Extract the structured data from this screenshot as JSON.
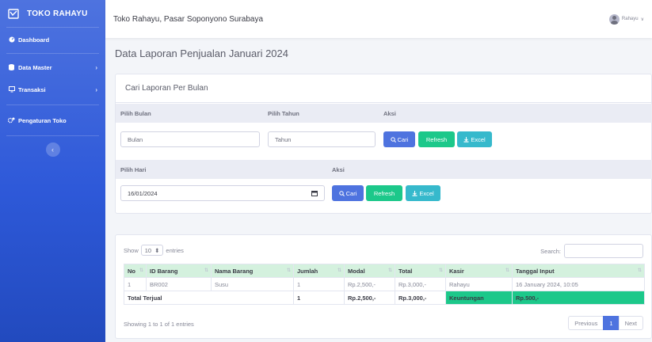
{
  "app": {
    "brand": "TOKO RAHAYU"
  },
  "sidebar": {
    "items": [
      {
        "label": "Dashboard",
        "icon": "tachometer-icon"
      },
      {
        "label": "Data Master",
        "icon": "database-icon"
      },
      {
        "label": "Transaksi",
        "icon": "desktop-icon"
      },
      {
        "label": "Pengaturan Toko",
        "icon": "cogs-icon"
      }
    ]
  },
  "topbar": {
    "title": "Toko Rahayu, Pasar Soponyono Surabaya",
    "user": "Rahayu"
  },
  "page": {
    "title": "Data Laporan Penjualan Januari 2024"
  },
  "filter": {
    "header": "Cari Laporan Per Bulan",
    "month_label": "Pilih Bulan",
    "year_label": "Pilih Tahun",
    "action_label": "Aksi",
    "month_placeholder": "Bulan",
    "year_placeholder": "Tahun",
    "day_label": "Pilih Hari",
    "day_action_label": "Aksi",
    "day_value": "16/01/2024",
    "btn_search": "Cari",
    "btn_refresh": "Refresh",
    "btn_excel": "Excel"
  },
  "table": {
    "show": "Show",
    "entries_value": "10",
    "entries": "entries",
    "search_label": "Search:",
    "columns": [
      "No",
      "ID Barang",
      "Nama Barang",
      "Jumlah",
      "Modal",
      "Total",
      "Kasir",
      "Tanggal Input"
    ],
    "rows": [
      [
        "1",
        "BR002",
        "Susu",
        "1",
        "Rp.2,500,-",
        "Rp.3,000,-",
        "Rahayu",
        "16 January 2024, 10:05"
      ]
    ],
    "total": {
      "label": "Total Terjual",
      "jumlah": "1",
      "modal": "Rp.2,500,-",
      "total": "Rp.3,000,-",
      "profit_label": "Keuntungan",
      "profit": "Rp.500,-"
    },
    "info": "Showing 1 to 1 of 1 entries",
    "pager": {
      "prev": "Previous",
      "page": "1",
      "next": "Next"
    }
  },
  "colors": {
    "sidebar": "#4e73df",
    "primary": "#4e73df",
    "success": "#1cc88a",
    "info": "#36b9cc",
    "header_row": "#d4f1de"
  }
}
